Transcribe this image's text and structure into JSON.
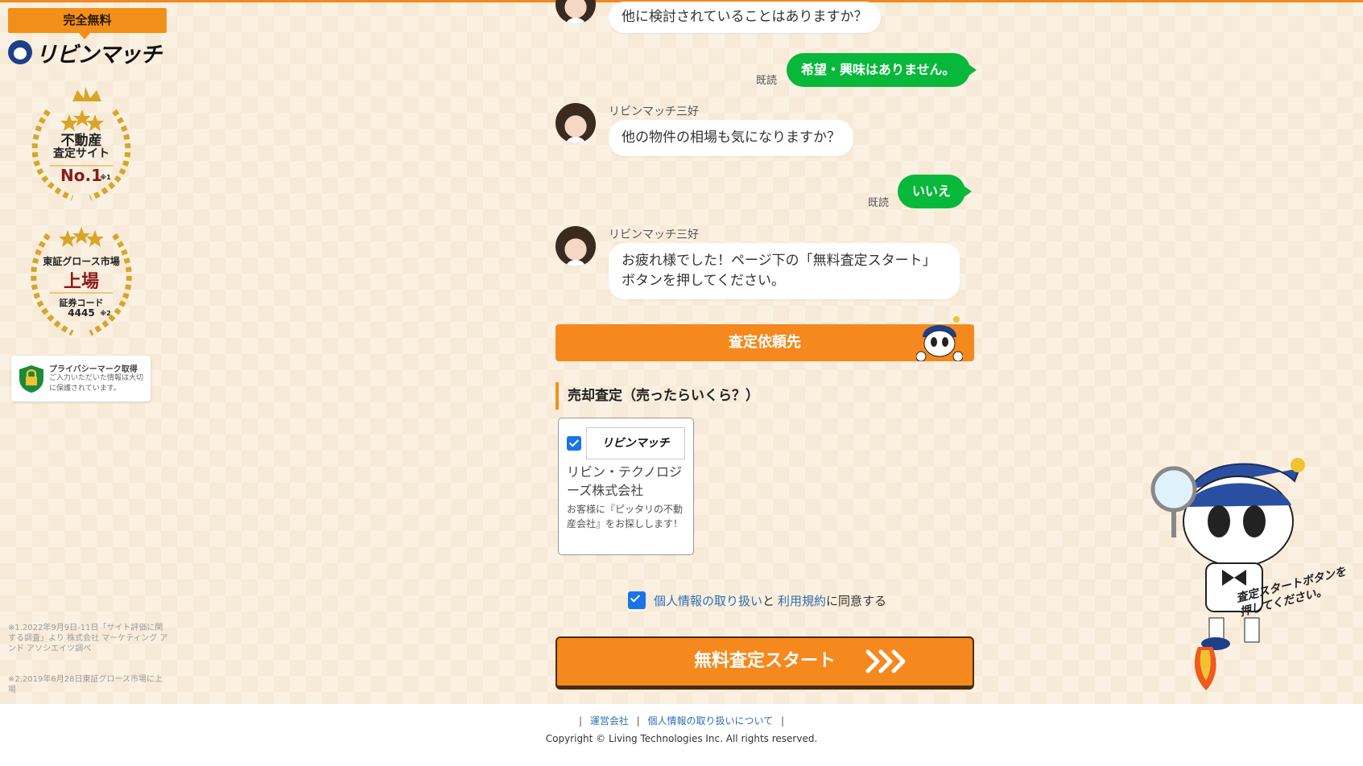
{
  "sidebar": {
    "free_badge": "完全無料",
    "logo_text": "リビンマッチ",
    "award1": {
      "line1": "不動産",
      "line2": "査定サイト",
      "rank": "No.1",
      "note": "※1"
    },
    "award2": {
      "line1": "東証グロース市場",
      "line2": "上場",
      "line3": "証券コード",
      "code": "4445",
      "note": "※2"
    },
    "privacy": {
      "title": "プライバシーマーク取得",
      "desc": "ご入力いただいた情報は大切に保護されています。"
    },
    "footnote1": "※1.2022年9月9日-11日「サイト評価に関する調査」より 株式会社 マーケティング アンド アソシエイツ調べ",
    "footnote2": "※2.2019年6月28日東証グロース市場に上場"
  },
  "chat": {
    "q_top": "他に検討されていることはありますか？",
    "answer1": "希望・興味はありません。",
    "read_label": "既読",
    "speaker": "リビンマッチ三好",
    "q2": "他の物件の相場も気になりますか？",
    "answer2": "いいえ",
    "final_msg": "お疲れ様でした！ページ下の「無料査定スタート」ボタンを押してください。"
  },
  "section_bar": {
    "label": "査定依頼先"
  },
  "sell_heading": "売却査定（売ったらいくら？）",
  "company": {
    "logo_text": "リビンマッチ",
    "name": "リビン・テクノロジーズ株式会社",
    "desc": "お客様に『ピッタリの不動産会社』をお探しします！",
    "checked": true
  },
  "agreement": {
    "link1": "個人情報の取り扱い",
    "mid": "と",
    "link2": "利用規約",
    "tail": "に同意する",
    "checked": true
  },
  "start_button": {
    "label": "無料査定スタート"
  },
  "mascot_caption": "査定スタートボタンを押してください。",
  "footer": {
    "sep": "|",
    "link1": "運営会社",
    "link2": "個人情報の取り扱いについて",
    "copyright": "Copyright © Living Technologies Inc. All rights reserved."
  },
  "colors": {
    "accent": "#f5891d",
    "bubble_green": "#08b83b",
    "link": "#2d6fb5"
  }
}
